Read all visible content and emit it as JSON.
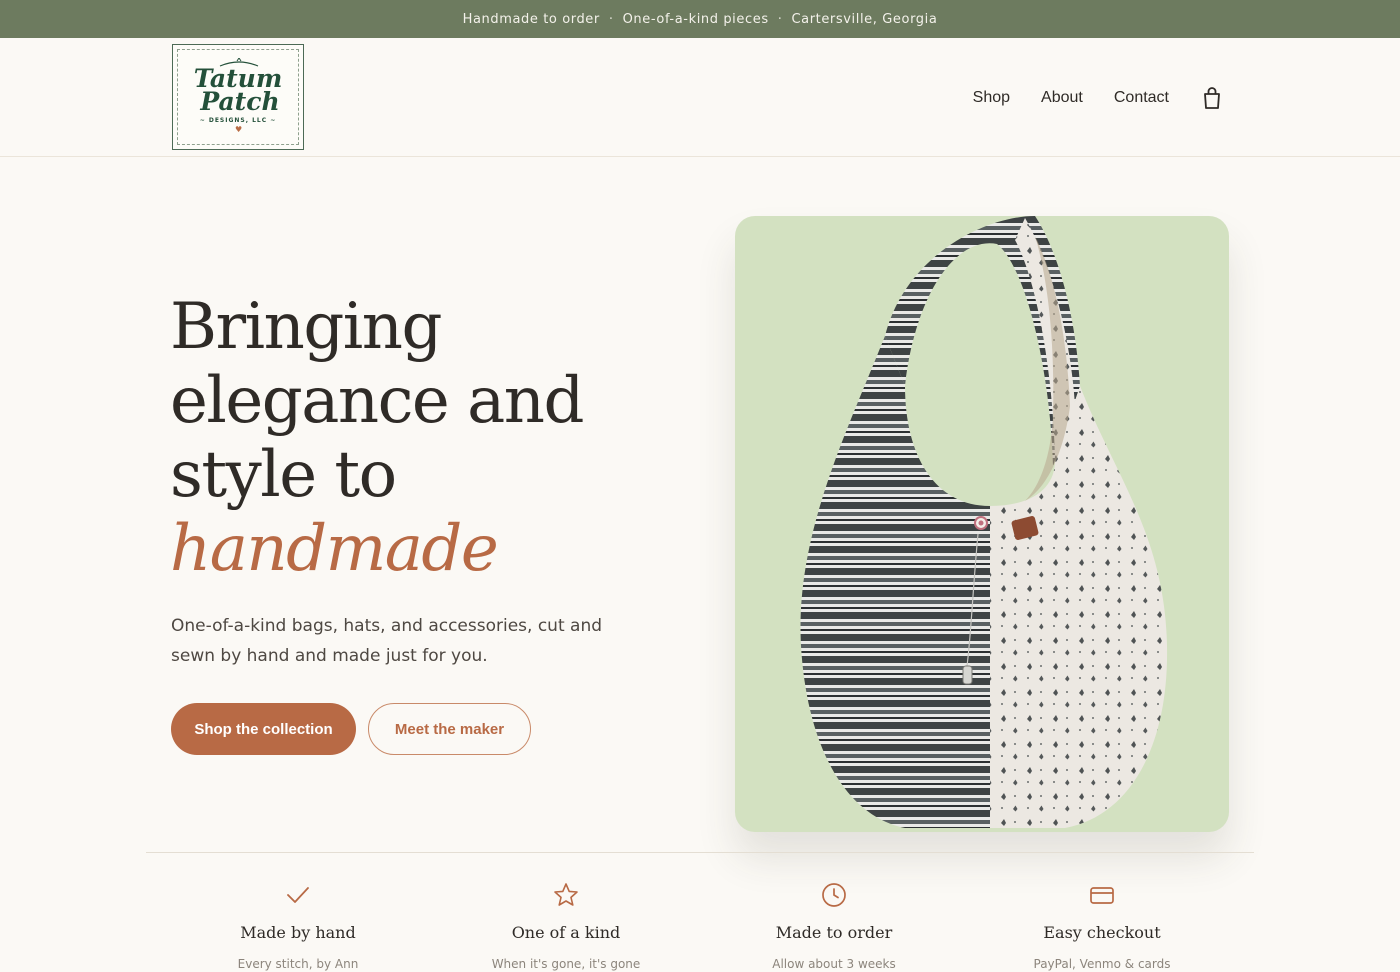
{
  "announcement": {
    "items": [
      "Handmade to order",
      "One-of-a-kind pieces",
      "Cartersville, Georgia"
    ],
    "separator": "·"
  },
  "logo": {
    "line1": "Tatum",
    "line2": "Patch",
    "subline": "~ DESIGNS, LLC ~"
  },
  "nav": {
    "items": [
      {
        "label": "Shop"
      },
      {
        "label": "About"
      },
      {
        "label": "Contact"
      }
    ],
    "cart_icon": "shopping-bag-icon"
  },
  "hero": {
    "title_lines": [
      "Bringing",
      "elegance and",
      "style to"
    ],
    "title_accent": "handmade",
    "subtitle": "One-of-a-kind bags, hats, and accessories, cut and sewn by hand and made just for you.",
    "primary_cta": "Shop the collection",
    "secondary_cta": "Meet the maker",
    "image_icon": "hobo-bag-photo"
  },
  "features": [
    {
      "icon": "check-icon",
      "title": "Made by hand",
      "description": "Every stitch, by Ann"
    },
    {
      "icon": "star-icon",
      "title": "One of a kind",
      "description": "When it's gone, it's gone"
    },
    {
      "icon": "clock-icon",
      "title": "Made to order",
      "description": "Allow about 3 weeks"
    },
    {
      "icon": "credit-card-icon",
      "title": "Easy checkout",
      "description": "PayPal, Venmo & cards"
    }
  ],
  "colors": {
    "topbar": "#6d7b5f",
    "accent": "#b86a45",
    "background": "#fbf9f5",
    "image_background": "#d3e1c1",
    "logo_green": "#24503a"
  }
}
